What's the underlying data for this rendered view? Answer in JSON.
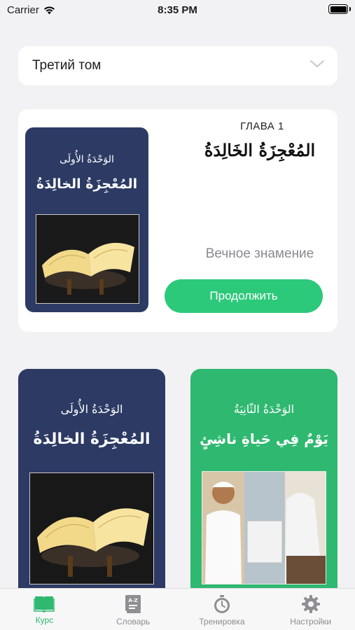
{
  "status_bar": {
    "carrier": "Carrier",
    "time": "8:35 PM"
  },
  "volume_selector": {
    "value": "Третий том"
  },
  "featured": {
    "cover": {
      "unit": "الوَحْدَةُ الأُولَى",
      "title": "المُعْجِزَةُ الخالِدَةُ"
    },
    "chapter_label": "ГЛАВА 1",
    "chapter_title_arabic": "المُعْجِزَةُ الخَالِدَةُ",
    "chapter_subtitle": "Вечное знамение",
    "continue_label": "Продолжить"
  },
  "units": [
    {
      "unit": "الوَحْدَةُ الأُولَى",
      "title": "المُعْجِزَةُ الخالِدَةُ",
      "color": "#2c3a64"
    },
    {
      "unit": "الوَحْدَةُ الثّانِيَةُ",
      "title": "يَوْمٌ فِي حَياةِ ناشِئٍ",
      "color": "#2fb870"
    }
  ],
  "tabs": [
    {
      "label": "Курс",
      "icon": "book-icon",
      "active": true
    },
    {
      "label": "Словарь",
      "icon": "dictionary-icon",
      "active": false
    },
    {
      "label": "Тренировка",
      "icon": "stopwatch-icon",
      "active": false
    },
    {
      "label": "Настройки",
      "icon": "gear-icon",
      "active": false
    }
  ],
  "colors": {
    "accent": "#2dc97a",
    "navy": "#2c3a64",
    "green": "#2fb870"
  }
}
